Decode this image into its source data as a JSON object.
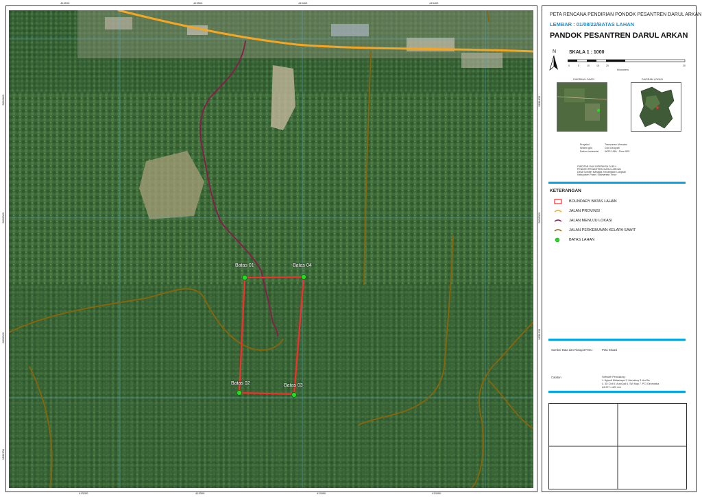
{
  "header": {
    "title": "PETA RENCANA PENDIRIAN PONDOK PESANTREN DARUL ARKAN",
    "sheet": "LEMBAR : 01/08/22/BATAS LAHAN",
    "subject": "PANDOK PESANTREN DARUL ARKAN"
  },
  "scale": {
    "north": "N",
    "label": "SKALA 1 : 1000",
    "ticks": [
      "0",
      "5",
      "10",
      "15",
      "20",
      "30"
    ],
    "unit": "Kilometers"
  },
  "insets": {
    "left_label": "DIAGRAM LOKASI",
    "right_label": "DIAGRAM LOKASI"
  },
  "projection": {
    "rows": [
      {
        "k": "Proyeksi",
        "v": "Transverse Mercator"
      },
      {
        "k": "Sistem grid",
        "v": "Grid Geografi"
      },
      {
        "k": "Datum horizontal",
        "v": "WGS 1984 - Zone 50S"
      }
    ],
    "credit": [
      "DIEDITAR DAN DIPERIKSA OLEH :",
      "PENDIRI PESANTREN DARUL ARKAN",
      "Desa Sumber Bahagia, Kecamatan Longkali",
      "Kabupaten Paser, Kalimantan Timur"
    ]
  },
  "legend": {
    "title": "KETERANGAN",
    "items": [
      {
        "label": "BOUNDARY BATAS LAHAN",
        "kind": "box",
        "color": "#ff2a2a"
      },
      {
        "label": "JALAN PROVINSI",
        "kind": "line",
        "color": "#f5a623"
      },
      {
        "label": "JALAN MENUJU LOKASI",
        "kind": "line",
        "color": "#8b1a4a"
      },
      {
        "label": "JALAN PERKEBUNAN KELAPA SAWIT",
        "kind": "line",
        "color": "#8b6508"
      },
      {
        "label": "BATAS LAHAN",
        "kind": "dot",
        "color": "#22dd22"
      }
    ]
  },
  "sources": {
    "label": "Sumber Data dan Riwayat Peta :",
    "value": "Peta Situasi"
  },
  "notes": {
    "label": "Catatan",
    "lines": [
      "Software Pendukung :",
      "1. Agisoft Metashape  2. Mendeley  3. ArcGis",
      "4. 3D Civil  5. AutoCad  6. SW Map  7. PCI Geomatica",
      "A3 297 x 420 mm"
    ]
  },
  "markers": {
    "b1": "Batas 01",
    "b2": "Batas 02",
    "b3": "Batas 03",
    "b4": "Batas 04"
  },
  "grid_ticks": {
    "top": [
      "413200",
      "413300",
      "413400"
    ],
    "bottom": [
      "413200",
      "413300",
      "413400"
    ],
    "left": [
      "9836400",
      "9836300",
      "9836200"
    ],
    "right": [
      "9836400",
      "9836300",
      "9836200"
    ]
  },
  "colors": {
    "boundary": "#ff2a2a",
    "provinsi": "#f5a623",
    "menuju": "#8b1a4a",
    "perkebunan": "#8b6508",
    "accent": "#00a6e6"
  }
}
